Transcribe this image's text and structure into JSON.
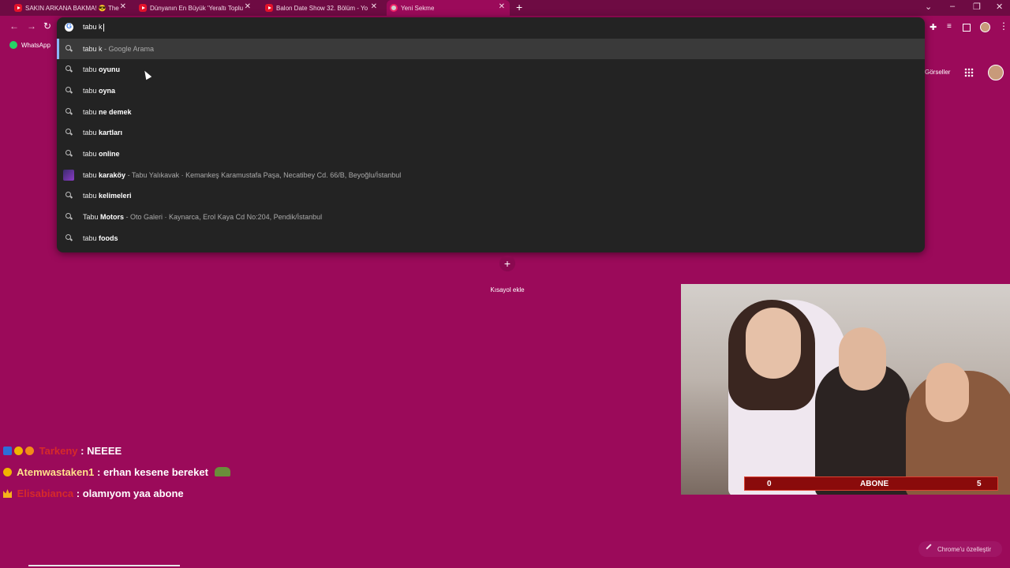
{
  "tabs": [
    {
      "title": "SAKIN ARKANA BAKMA! 😎 The",
      "favicon": "youtube-icon",
      "active": false
    },
    {
      "title": "Dünyanın En Büyük 'Yeraltı Toplu",
      "favicon": "youtube-icon",
      "active": false
    },
    {
      "title": "Balon Date Show 32. Bölüm - Yo",
      "favicon": "youtube-icon",
      "active": false
    },
    {
      "title": "Yeni Sekme",
      "favicon": "chrome-icon",
      "active": true
    }
  ],
  "bookmarks": [
    {
      "label": "WhatsApp",
      "icon": "whatsapp-icon"
    }
  ],
  "omnibox": {
    "query": "tabu k",
    "suggestions": [
      {
        "plain": "tabu k",
        "bold": "",
        "meta": " - Google Arama",
        "icon": "search-icon"
      },
      {
        "plain": "tabu ",
        "bold": "oyunu",
        "meta": "",
        "icon": "search-icon"
      },
      {
        "plain": "tabu ",
        "bold": "oyna",
        "meta": "",
        "icon": "search-icon"
      },
      {
        "plain": "tabu ",
        "bold": "ne demek",
        "meta": "",
        "icon": "search-icon"
      },
      {
        "plain": "tabu ",
        "bold": "kartları",
        "meta": "",
        "icon": "search-icon"
      },
      {
        "plain": "tabu ",
        "bold": "online",
        "meta": "",
        "icon": "search-icon"
      },
      {
        "plain": "tabu ",
        "bold": "karaköy",
        "meta": " - Tabu Yalıkavak · Kemankeş Karamustafa Paşa, Necatibey Cd. 66/B, Beyoğlu/İstanbul",
        "icon": "place-thumbnail"
      },
      {
        "plain": "tabu ",
        "bold": "kelimeleri",
        "meta": "",
        "icon": "search-icon"
      },
      {
        "plain": "Tabu ",
        "bold": "Motors",
        "meta": " - Oto Galeri · Kaynarca, Erol Kaya Cd No:204, Pendik/İstanbul",
        "icon": "search-icon"
      },
      {
        "plain": "tabu ",
        "bold": "foods",
        "meta": "",
        "icon": "search-icon"
      }
    ]
  },
  "header": {
    "images_label": "Görseller"
  },
  "shortcut": {
    "plus": "+",
    "label": "Kısayol ekle"
  },
  "webcam_overlay": {
    "left": "0",
    "center": "ABONE",
    "right": "5"
  },
  "chat": [
    {
      "user": "Tarkeny",
      "message": ": NEEEE"
    },
    {
      "user": "Atemwastaken1",
      "message": ": erhan kesene bereket"
    },
    {
      "user": "Elisabianca",
      "message": ": olamıyom yaa abone"
    }
  ],
  "customize_label": "Chrome'u özelleştir",
  "colors": {
    "background": "#9b0a5a",
    "tabstrip": "#6e0b43",
    "dropdown": "#232323"
  }
}
